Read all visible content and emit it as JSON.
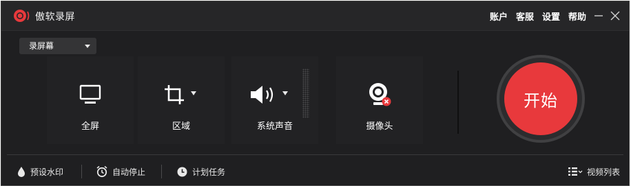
{
  "app": {
    "title": "傲软录屏",
    "logo": "recorder-logo"
  },
  "title_menu": {
    "account": "账户",
    "service": "客服",
    "settings": "设置",
    "help": "帮助"
  },
  "mode_dropdown": {
    "selected": "录屏幕"
  },
  "sources": {
    "fullscreen": {
      "label": "全屏",
      "icon": "monitor-icon"
    },
    "region": {
      "label": "区域",
      "icon": "crop-icon"
    },
    "system_audio": {
      "label": "系统声音",
      "icon": "speaker-icon"
    },
    "camera": {
      "label": "摄像头",
      "icon": "webcam-icon",
      "state": "disabled"
    }
  },
  "start_button": {
    "label": "开始"
  },
  "bottom_bar": {
    "watermark": "预设水印",
    "auto_stop": "自动停止",
    "schedule": "计划任务",
    "video_list": "视频列表"
  },
  "colors": {
    "accent": "#e8393c",
    "background": "#1f1f21"
  }
}
